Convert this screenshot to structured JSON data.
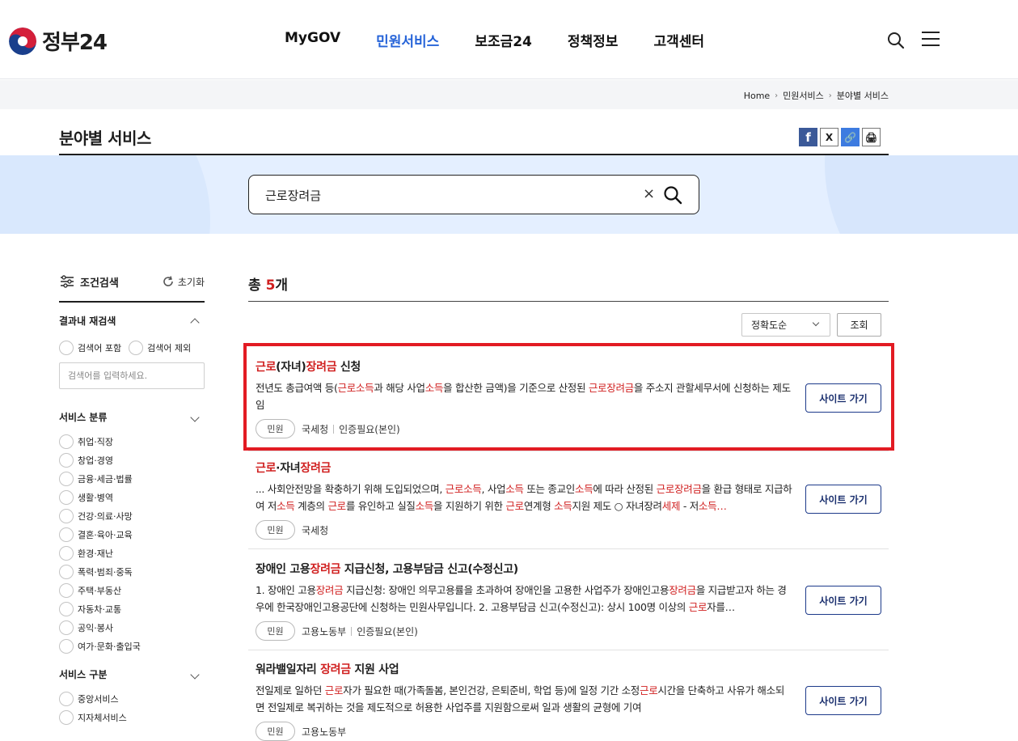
{
  "header": {
    "logo_text": "정부24",
    "nav": [
      "MyGOV",
      "민원서비스",
      "보조금24",
      "정책정보",
      "고객센터"
    ],
    "active_nav": "민원서비스"
  },
  "breadcrumb": [
    "Home",
    "민원서비스",
    "분야별 서비스"
  ],
  "page_title": "분야별 서비스",
  "share": {
    "facebook": "f",
    "x": "X",
    "link": "🔗",
    "print": "🖨"
  },
  "search": {
    "value": "근로장려금",
    "clear": "×"
  },
  "sidebar": {
    "title": "조건검색",
    "reset": "초기화",
    "section_refine": "결과내 재검색",
    "include_label": "검색어 포함",
    "exclude_label": "검색어 제외",
    "keyword_placeholder": "검색어를 입력하세요.",
    "section_category": "서비스 분류",
    "categories": [
      "취업·직장",
      "창업·경영",
      "금융·세금·법률",
      "생활·병역",
      "건강·의료·사망",
      "결혼·육아·교육",
      "환경·재난",
      "폭력·범죄·중독",
      "주택·부동산",
      "자동차·교통",
      "공익·봉사",
      "여가·문화·출입국"
    ],
    "section_type": "서비스 구분",
    "types": [
      "중앙서비스",
      "지자체서비스"
    ]
  },
  "results": {
    "total_prefix": "총 ",
    "total_count": "5",
    "total_suffix": "개",
    "sort_label": "정확도순",
    "view_button": "조회",
    "go_label": "사이트 가기",
    "items": [
      {
        "title": [
          {
            "t": "근로",
            "hl": true
          },
          {
            "t": "(자녀)"
          },
          {
            "t": "장려금",
            "hl": true
          },
          {
            "t": " 신청"
          }
        ],
        "desc": [
          {
            "t": "전년도 총급여액 등("
          },
          {
            "t": "근로소득",
            "hl": true
          },
          {
            "t": "과 해당 사업"
          },
          {
            "t": "소득",
            "hl": true
          },
          {
            "t": "을 합산한 금액)을 기준으로 산정된 "
          },
          {
            "t": "근로장려금",
            "hl": true
          },
          {
            "t": "을 주소지 관할세무서에 신청하는 제도임"
          }
        ],
        "tag": "민원",
        "org": "국세청",
        "auth": "인증필요(본인)"
      },
      {
        "title": [
          {
            "t": "근로",
            "hl": true
          },
          {
            "t": "·자녀"
          },
          {
            "t": "장려금",
            "hl": true
          }
        ],
        "desc": [
          {
            "t": "... 사회안전망을 확충하기 위해 도입되었으며, "
          },
          {
            "t": "근로소득",
            "hl": true
          },
          {
            "t": ", 사업"
          },
          {
            "t": "소득",
            "hl": true
          },
          {
            "t": " 또는 종교인"
          },
          {
            "t": "소득",
            "hl": true
          },
          {
            "t": "에 따라 산정된 "
          },
          {
            "t": "근로장려금",
            "hl": true
          },
          {
            "t": "을 환급 형태로 지급하여 저"
          },
          {
            "t": "소득",
            "hl": true
          },
          {
            "t": " 계층의 "
          },
          {
            "t": "근로",
            "hl": true
          },
          {
            "t": "를 유인하고 실질"
          },
          {
            "t": "소득",
            "hl": true
          },
          {
            "t": "을 지원하기 위한 "
          },
          {
            "t": "근로",
            "hl": true
          },
          {
            "t": "연계형 "
          },
          {
            "t": "소득",
            "hl": true
          },
          {
            "t": "지원 제도 ○ 자녀장려"
          },
          {
            "t": "세제",
            "hl": true
          },
          {
            "t": " - 저"
          },
          {
            "t": "소득…",
            "hl": true
          }
        ],
        "tag": "민원",
        "org": "국세청",
        "auth": ""
      },
      {
        "title": [
          {
            "t": "장애인 고용"
          },
          {
            "t": "장려금",
            "hl": true
          },
          {
            "t": " 지급신청, 고용부담금 신고(수정신고)"
          }
        ],
        "desc": [
          {
            "t": "1. 장애인 고용"
          },
          {
            "t": "장려금",
            "hl": true
          },
          {
            "t": " 지급신청: 장애인 의무고용률을 초과하여 장애인을 고용한 사업주가 장애인고용"
          },
          {
            "t": "장려금",
            "hl": true
          },
          {
            "t": "을 지급받고자 하는 경우에 한국장애인고용공단에 신청하는 민원사무입니다. 2. 고용부담금 신고(수정신고): 상시 100명 이상의 "
          },
          {
            "t": "근로",
            "hl": true
          },
          {
            "t": "자를…"
          }
        ],
        "tag": "민원",
        "org": "고용노동부",
        "auth": "인증필요(본인)"
      },
      {
        "title": [
          {
            "t": "워라밸일자리 "
          },
          {
            "t": "장려금",
            "hl": true
          },
          {
            "t": " 지원 사업"
          }
        ],
        "desc": [
          {
            "t": "전일제로 일하던 "
          },
          {
            "t": "근로",
            "hl": true
          },
          {
            "t": "자가 필요한 때(가족돌봄, 본인건강, 은퇴준비, 학업 등)에 일정 기간 소정"
          },
          {
            "t": "근로",
            "hl": true
          },
          {
            "t": "시간을 단축하고 사유가 해소되면 전일제로 복귀하는 것을 제도적으로 허용한 사업주를 지원함으로써 일과 생활의 균형에 기여"
          }
        ],
        "tag": "민원",
        "org": "고용노동부",
        "auth": ""
      }
    ]
  }
}
